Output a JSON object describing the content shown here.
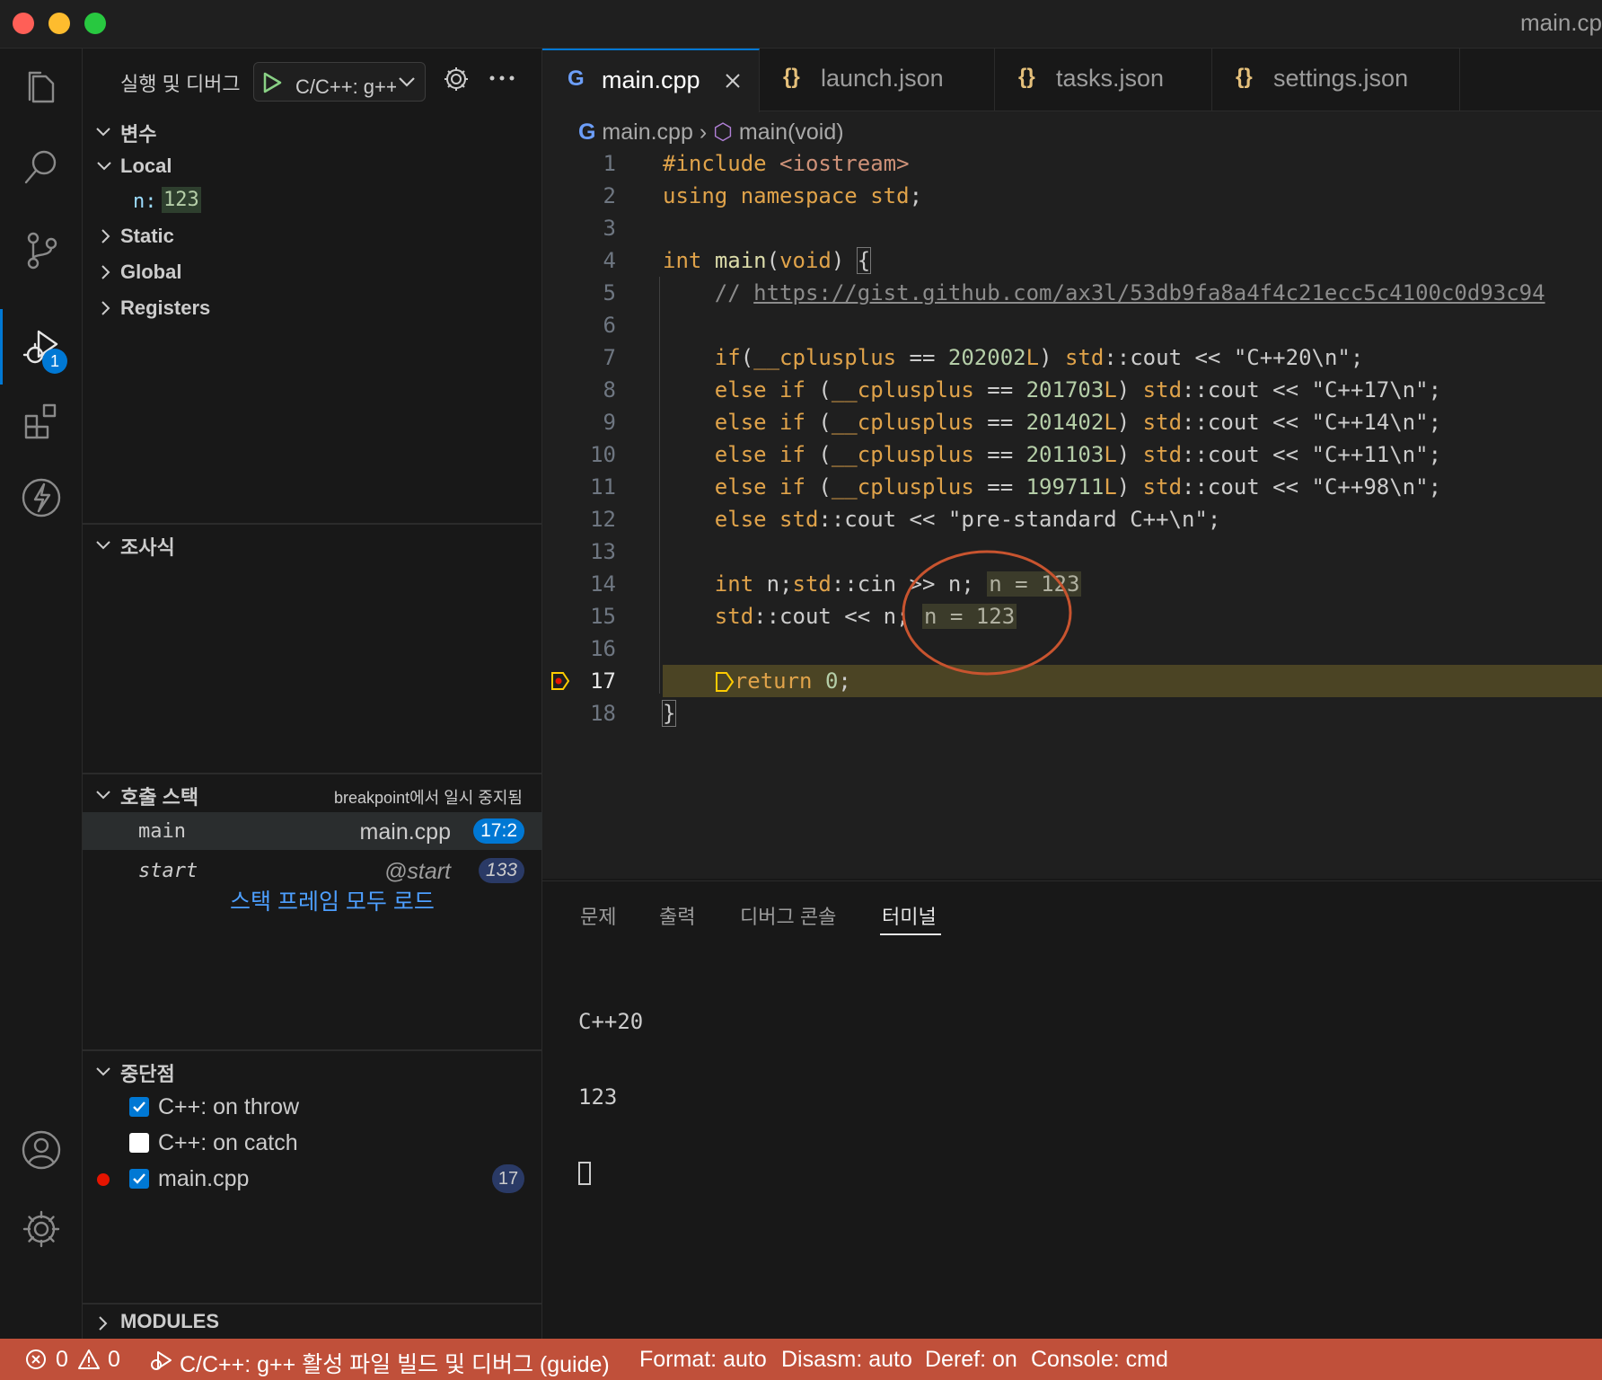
{
  "window": {
    "title": "main.cp"
  },
  "activity_bar": {
    "debug_badge": "1"
  },
  "sidebar": {
    "title": "실행 및 디버그",
    "config_label": "C/C++: g++ 활성 파일 빌드 및 디버그",
    "variables": {
      "header": "변수",
      "local": "Local",
      "var_name": "n:",
      "var_value": "123",
      "static": "Static",
      "global": "Global",
      "registers": "Registers"
    },
    "watch": {
      "header": "조사식"
    },
    "callstack": {
      "header": "호출 스택",
      "status": "breakpoint에서 일시 중지됨",
      "frames": [
        {
          "name": "main",
          "file": "main.cpp",
          "pos": "17:2"
        },
        {
          "name": "start",
          "file": "@start",
          "pos": "133"
        }
      ],
      "load_all": "스택 프레임 모두 로드"
    },
    "breakpoints": {
      "header": "중단점",
      "items": [
        {
          "label": "C++: on throw",
          "checked": true
        },
        {
          "label": "C++: on catch",
          "checked": false
        },
        {
          "label": "main.cpp",
          "checked": true,
          "line": "17"
        }
      ]
    },
    "modules": {
      "header": "MODULES"
    }
  },
  "tabs": [
    {
      "label": "main.cpp",
      "active": true
    },
    {
      "label": "launch.json"
    },
    {
      "label": "tasks.json"
    },
    {
      "label": "settings.json"
    }
  ],
  "breadcrumb": {
    "file": "main.cpp",
    "symbol": "main(void)"
  },
  "code": {
    "lines": [
      "1",
      "2",
      "3",
      "4",
      "5",
      "6",
      "7",
      "8",
      "9",
      "10",
      "11",
      "12",
      "13",
      "14",
      "15",
      "16",
      "17",
      "18"
    ],
    "url": "https://gist.github.com/ax3l/53db9fa8a4f4c21ecc5c4100c0d93c94",
    "inline_14": "n = 123",
    "inline_15": "n = 123"
  },
  "panel": {
    "tabs": [
      "문제",
      "출력",
      "디버그 콘솔",
      "터미널"
    ],
    "active": "터미널",
    "terminal": [
      "C++20",
      "123"
    ]
  },
  "statusbar": {
    "errors": "0",
    "warnings": "0",
    "launch": "C/C++: g++ 활성 파일 빌드 및 디버그 (guide)",
    "format": "Format: auto",
    "disasm": "Disasm: auto",
    "deref": "Deref: on",
    "console": "Console: cmd"
  },
  "colors": {
    "accent": "#0078d4",
    "statusbar": "#c0503a",
    "current_line": "#4b4424",
    "annotation_circle": "#c8542f"
  }
}
